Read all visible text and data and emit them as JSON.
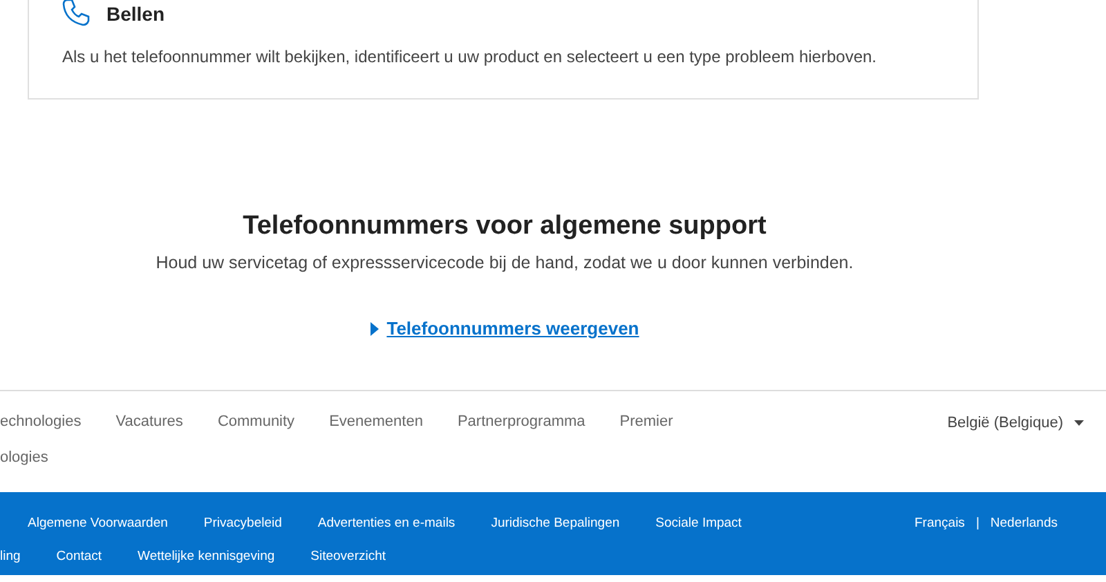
{
  "call_card": {
    "title": "Bellen",
    "text": "Als u het telefoonnummer wilt bekijken, identificeert u uw product en selecteert u een type probleem hierboven."
  },
  "general_support": {
    "heading": "Telefoonnummers voor algemene support",
    "subtitle": "Houd uw servicetag of expressservicecode bij de hand, zodat we u door kunnen verbinden.",
    "link": "Telefoonnummers weergeven",
    "expanded": false
  },
  "footer_nav": {
    "row_1": [
      "echnologies",
      "Vacatures",
      "Community",
      "Evenementen",
      "Partnerprogramma",
      "Premier"
    ],
    "row_2": [
      "ologies"
    ],
    "region": "België (Belgique)"
  },
  "legal_bar": {
    "row_1": [
      "Algemene Voorwaarden",
      "Privacybeleid",
      "Advertenties en e-mails",
      "Juridische Bepalingen",
      "Sociale Impact"
    ],
    "row_2": [
      "ling",
      "Contact",
      "Wettelijke kennisgeving",
      "Siteoverzicht"
    ],
    "languages": [
      "Français",
      "Nederlands"
    ],
    "language_separator": "|"
  }
}
